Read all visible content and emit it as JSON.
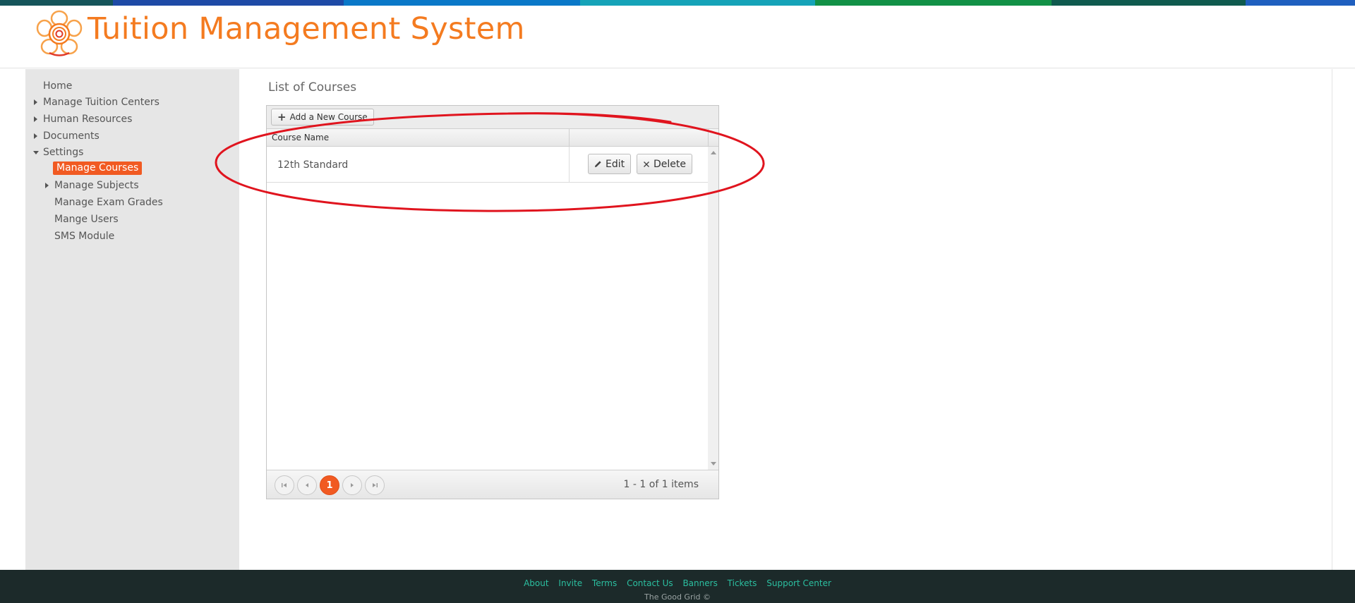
{
  "header": {
    "title": "Tuition Management System"
  },
  "stripe_colors": [
    "#15555a",
    "#1e4aa6",
    "#0a78c8",
    "#15a3b8",
    "#129146",
    "#0f5a4e",
    "#1f5fbf"
  ],
  "sidebar": {
    "items": [
      {
        "label": "Home"
      },
      {
        "label": "Manage Tuition Centers"
      },
      {
        "label": "Human Resources"
      },
      {
        "label": "Documents"
      },
      {
        "label": "Settings"
      },
      {
        "label": "Manage Courses"
      },
      {
        "label": "Manage Subjects"
      },
      {
        "label": "Manage Exam Grades"
      },
      {
        "label": "Mange Users"
      },
      {
        "label": "SMS Module"
      }
    ],
    "active_color": "#f15a22"
  },
  "main": {
    "title": "List of Courses",
    "add_button_label": "Add a New Course",
    "columns": [
      "Course Name"
    ],
    "rows": [
      {
        "name": "12th Standard",
        "edit_label": "Edit",
        "delete_label": "Delete"
      }
    ],
    "pager": {
      "current_page": "1",
      "info": "1 - 1 of 1 items"
    }
  },
  "annotation_color": "#e0141e",
  "footer": {
    "links": [
      "About",
      "Invite",
      "Terms",
      "Contact Us",
      "Banners",
      "Tickets",
      "Support Center"
    ],
    "copyright": "The Good Grid ©"
  }
}
